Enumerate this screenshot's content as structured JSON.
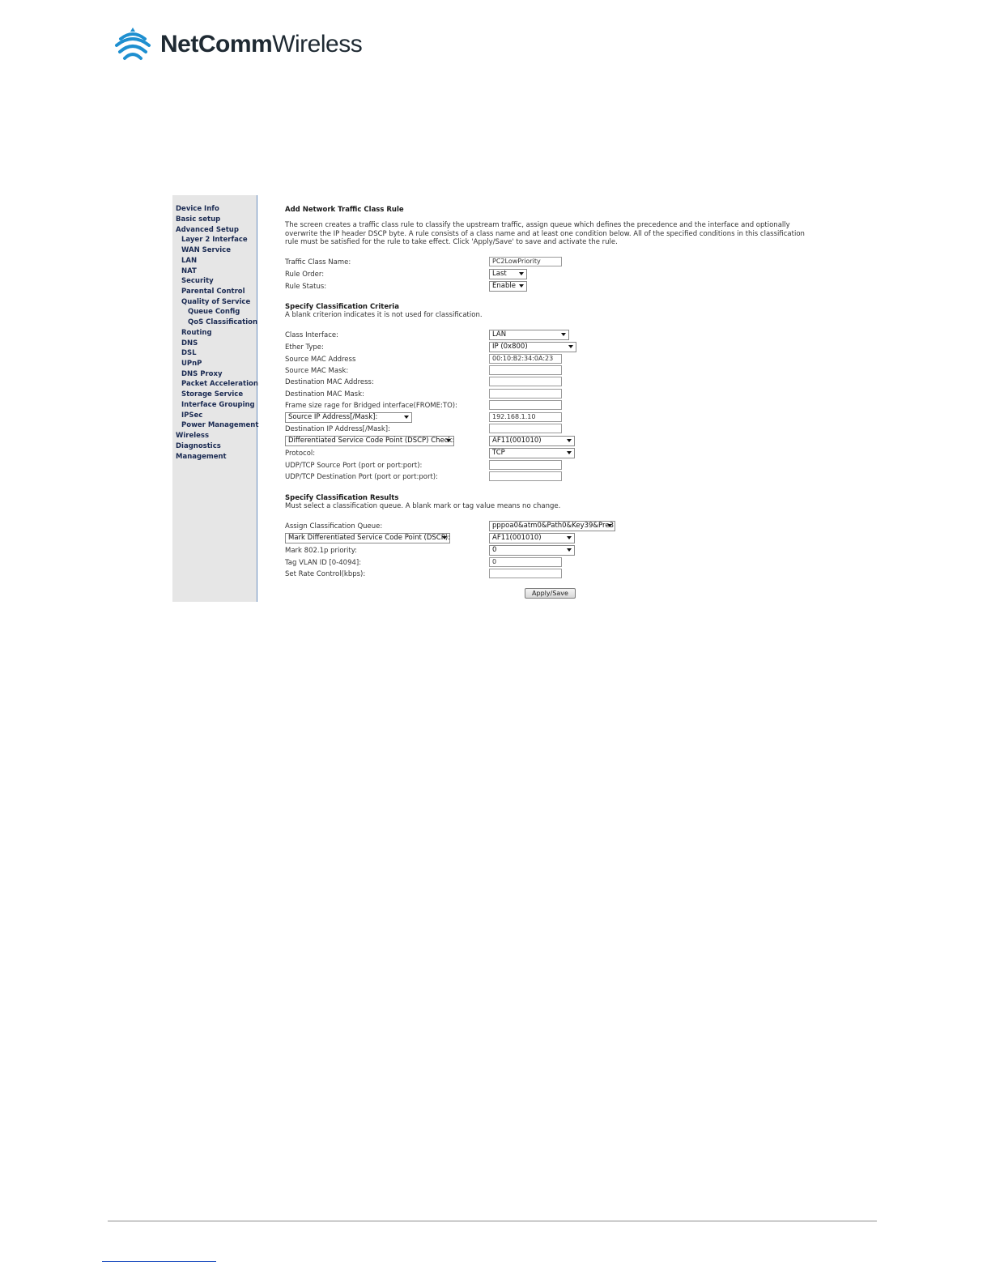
{
  "brand": {
    "name_bold": "NetComm",
    "name_light": "Wireless"
  },
  "sidebar": {
    "items": [
      "Device Info",
      "Basic setup",
      "Advanced Setup",
      "Layer 2 Interface",
      "WAN Service",
      "LAN",
      "NAT",
      "Security",
      "Parental Control",
      "Quality of Service",
      "Queue Config",
      "QoS Classification",
      "Routing",
      "DNS",
      "DSL",
      "UPnP",
      "DNS Proxy",
      "Packet Acceleration",
      "Storage Service",
      "Interface Grouping",
      "IPSec",
      "Power Management",
      "Wireless",
      "Diagnostics",
      "Management"
    ]
  },
  "form": {
    "title": "Add Network Traffic Class Rule",
    "description": "The screen creates a traffic class rule to classify the upstream traffic, assign queue which defines the precedence and the interface and optionally overwrite the IP header DSCP byte. A rule consists of a class name and at least one condition below. All of the specified conditions in this classification rule must be satisfied for the rule to take effect. Click 'Apply/Save' to save and activate the rule.",
    "traffic_class_name_label": "Traffic Class Name:",
    "traffic_class_name_value": "PC2LowPriority",
    "rule_order_label": "Rule Order:",
    "rule_order_value": "Last",
    "rule_status_label": "Rule Status:",
    "rule_status_value": "Enable",
    "criteria_title": "Specify Classification Criteria",
    "criteria_note": "A blank criterion indicates it is not used for classification.",
    "class_interface_label": "Class Interface:",
    "class_interface_value": "LAN",
    "ether_type_label": "Ether Type:",
    "ether_type_value": "IP (0x800)",
    "src_mac_label": "Source MAC Address",
    "src_mac_value": "00:10:B2:34:0A:23",
    "src_mac_mask_label": "Source MAC Mask:",
    "dst_mac_label": "Destination MAC Address:",
    "dst_mac_mask_label": "Destination MAC Mask:",
    "frame_size_label": "Frame size rage for Bridged interface(FROME:TO):",
    "src_ip_select": "Source IP Address[/Mask]:",
    "src_ip_value": "192.168.1.10",
    "dst_ip_label": "Destination IP Address[/Mask]:",
    "dscp_check_select": "Differentiated Service Code Point (DSCP) Check:",
    "dscp_check_value": "AF11(001010)",
    "protocol_label": "Protocol:",
    "protocol_value": "TCP",
    "src_port_label": "UDP/TCP Source Port (port or port:port):",
    "dst_port_label": "UDP/TCP Destination Port (port or port:port):",
    "results_title": "Specify Classification Results",
    "results_note": "Must select a classification queue. A blank mark or tag value means no change.",
    "assign_queue_label": "Assign Classification Queue:",
    "assign_queue_value": "pppoa0&atm0&Path0&Key39&Pre3",
    "mark_dscp_select": "Mark Differentiated Service Code Point (DSCP):",
    "mark_dscp_value": "AF11(001010)",
    "mark_8021p_label": "Mark 802.1p priority:",
    "mark_8021p_value": "0",
    "tag_vlan_label": "Tag VLAN ID [0-4094]:",
    "tag_vlan_value": "0",
    "rate_control_label": "Set Rate Control(kbps):",
    "apply_button": "Apply/Save"
  }
}
